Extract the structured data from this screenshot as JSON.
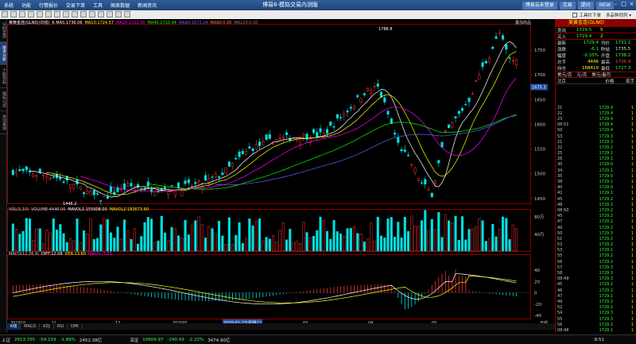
{
  "menu": [
    "系统",
    "功能",
    "行情报价",
    "交易下单",
    "工具",
    "图表数据",
    "新闻资讯"
  ],
  "app_title": "博易6-模拟交易内测版",
  "title_buttons": {
    "login": "博易云未登录",
    "trade": "交易",
    "help": "提问",
    "new": "NEW"
  },
  "toolbar_options": {
    "trading_toolbar": "工具栏下单",
    "multi_variety": "多品种同列"
  },
  "sidebar_tabs": [
    "分时走势",
    "技术分析",
    "个股资料",
    "指标公式",
    "关注板块"
  ],
  "chart_header": {
    "symbol": "黄黄金连(GLN0)(日线)",
    "ma_labels": [
      "K MA5:1736.06",
      "MA10:1724.57",
      "MA20:1722.30",
      "MA40:1710.94",
      "MA60:1673.24",
      "MA90:0.00",
      "MA120:0.00"
    ],
    "ma_colors": [
      "#ffffff",
      "#ffff00",
      "#ff00ff",
      "#00ff00",
      "#6060ff",
      "#ff8040",
      "#808080"
    ],
    "overlay_label": "叠加商品"
  },
  "vol_header": {
    "labels": [
      "VOL(5,10)",
      "VOLUME:4446.00",
      "MAVOL1:155908.00",
      "MAVOL2:183673.60"
    ],
    "colors": [
      "#cccccc",
      "#cccccc",
      "#ffffff",
      "#ffff00"
    ]
  },
  "macd_header": {
    "labels": [
      "MACD(12,26,9)",
      "DIFF:12.08",
      "DEA:13.60",
      "MACD:-3.03"
    ],
    "colors": [
      "#cccccc",
      "#ffffff",
      "#ffff00",
      "#ff00ff"
    ]
  },
  "price_axis": [
    "1750",
    "1700",
    "1650",
    "1600",
    "1550",
    "1500",
    "1450"
  ],
  "vol_axis": [
    "80万",
    "40万"
  ],
  "macd_axis": [
    "40",
    "20",
    "0",
    "-20",
    "-40"
  ],
  "current_price_tag": "1675.3",
  "high_label": "1788.8",
  "low_label": "1446.2",
  "date_axis": [
    "201910",
    "11",
    "12",
    "202001",
    "2020-01-22(星期三)",
    "03",
    "04",
    "05"
  ],
  "date_axis_right": "日线",
  "quote": {
    "title": "美黄金连(GLN0)",
    "sell_label": "卖出",
    "sell_price": "1729.5",
    "sell_vol": "5",
    "buy_label": "买入",
    "buy_price": "1729.4",
    "buy_vol": "2",
    "rows": [
      {
        "l1": "最新",
        "v1": "1729.4",
        "l2": "均价",
        "v2": "1731.1"
      },
      {
        "l1": "涨跌",
        "v1": "-6.1",
        "l2": "昨结",
        "v2": "1735.5"
      },
      {
        "l1": "幅度",
        "v1": "-0.35%",
        "l2": "开盘",
        "v2": "1738.2"
      },
      {
        "l1": "总手",
        "v1": "4446",
        "l2": "最高",
        "v2": "1736.9"
      },
      {
        "l1": "持仓",
        "v1": "168419",
        "l2": "最低",
        "v2": "1727.3"
      }
    ],
    "unit_tabs": [
      "美元/克",
      "元/克",
      "美元/盎司"
    ],
    "tick_header": [
      "北京",
      "价格",
      "现手"
    ]
  },
  "ticks": [
    {
      "t": "21",
      "p": "1729.4",
      "v": "1"
    },
    {
      "t": "22",
      "p": "1729.4",
      "v": "1"
    },
    {
      "t": "23",
      "p": "1729.4",
      "v": "1"
    },
    {
      "t": "08:51",
      "p": "1729.4",
      "v": "1"
    },
    {
      "t": "50",
      "p": "1729.4",
      "v": "1"
    },
    {
      "t": "53",
      "p": "1729.3",
      "v": "1"
    },
    {
      "t": "21",
      "p": "1729.3",
      "v": "1"
    },
    {
      "t": "22",
      "p": "1729.2",
      "v": "1"
    },
    {
      "t": "25",
      "p": "1729.1",
      "v": "1"
    },
    {
      "t": "26",
      "p": "1729.1",
      "v": "1"
    },
    {
      "t": "30",
      "p": "1729.0",
      "v": "1"
    },
    {
      "t": "34",
      "p": "1729.1",
      "v": "1"
    },
    {
      "t": "35",
      "p": "1729.0",
      "v": "1"
    },
    {
      "t": "38",
      "p": "1729.1",
      "v": "1"
    },
    {
      "t": "40",
      "p": "1729.0",
      "v": "1"
    },
    {
      "t": "42",
      "p": "1729.1",
      "v": "1"
    },
    {
      "t": "45",
      "p": "1729.2",
      "v": "1"
    },
    {
      "t": "48",
      "p": "1729.2",
      "v": "1"
    },
    {
      "t": "08:50",
      "p": "1729.2",
      "v": "1"
    },
    {
      "t": "45",
      "p": "1729.2",
      "v": "1"
    },
    {
      "t": "47",
      "p": "1729.2",
      "v": "1"
    },
    {
      "t": "49",
      "p": "1729.2",
      "v": "1"
    },
    {
      "t": "50",
      "p": "1729.3",
      "v": "1"
    },
    {
      "t": "51",
      "p": "1729.2",
      "v": "1"
    },
    {
      "t": "52",
      "p": "1729.2",
      "v": "1"
    },
    {
      "t": "53",
      "p": "1729.1",
      "v": "1"
    },
    {
      "t": "55",
      "p": "1729.2",
      "v": "1"
    },
    {
      "t": "56",
      "p": "1729.2",
      "v": "1"
    },
    {
      "t": "57",
      "p": "1729.3",
      "v": "1"
    },
    {
      "t": "58",
      "p": "1729.3",
      "v": "1"
    },
    {
      "t": "08:49",
      "p": "1729.3",
      "v": "1"
    },
    {
      "t": "45",
      "p": "1729.2",
      "v": "1"
    },
    {
      "t": "46",
      "p": "1729.2",
      "v": "1"
    },
    {
      "t": "47",
      "p": "1729.1",
      "v": "1"
    },
    {
      "t": "49",
      "p": "1729.2",
      "v": "1"
    },
    {
      "t": "52",
      "p": "1729.2",
      "v": "1"
    },
    {
      "t": "54",
      "p": "1729.3",
      "v": "1"
    },
    {
      "t": "55",
      "p": "1729.3",
      "v": "1"
    },
    {
      "t": "56",
      "p": "1729.2",
      "v": "1"
    },
    {
      "t": "08:48",
      "p": "1729.1",
      "v": "1"
    }
  ],
  "bottom_tabs": [
    "K线",
    "MACD",
    "KDJ",
    "RSI",
    "DMI"
  ],
  "status": {
    "sh_label": "上证",
    "sh_val": "2813.765",
    "sh_chg": "-54.159",
    "sh_pct": "-1.89%",
    "sh_amt": "2452.38亿",
    "sz_label": "深证",
    "sz_val": "10604.97",
    "sz_chg": "-240.43",
    "sz_pct": "-2.22%",
    "sz_amt": "3474.90亿",
    "time": "8:51"
  },
  "chart_data": {
    "type": "candlestick",
    "symbol": "GLN0",
    "period": "daily",
    "ylim": [
      1440,
      1800
    ],
    "last_close": 1729.4,
    "high": 1788.8,
    "low": 1446.2,
    "ma": {
      "MA5": 1736.06,
      "MA10": 1724.57,
      "MA20": 1722.3,
      "MA40": 1710.94,
      "MA60": 1673.24
    },
    "volume": {
      "VOLUME": 4446,
      "MAVOL1": 155908,
      "MAVOL2": 183673.6
    },
    "macd": {
      "DIFF": 12.08,
      "DEA": 13.6,
      "MACD": -3.03
    }
  }
}
